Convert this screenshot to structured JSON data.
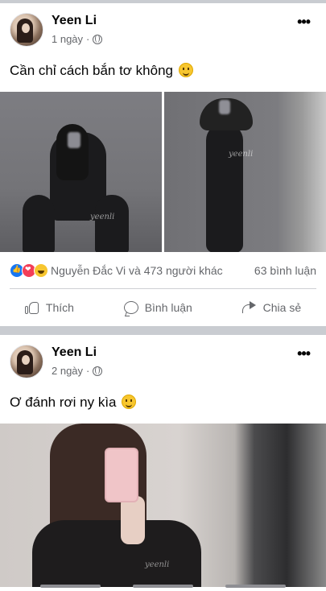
{
  "posts": [
    {
      "author": "Yeen Li",
      "time": "1 ngày",
      "caption": "Cần chỉ cách bắn tơ không",
      "reactions": {
        "icons": [
          "like-icon",
          "love-icon",
          "haha-icon"
        ],
        "text": "Nguyễn Đắc Vi và 473 người khác",
        "comments": "63 bình luận"
      },
      "actions": {
        "like": "Thích",
        "comment": "Bình luận",
        "share": "Chia sẻ"
      }
    },
    {
      "author": "Yeen Li",
      "time": "2 ngày",
      "caption": "Ơ đánh rơi ny kìa"
    }
  ],
  "colors": {
    "separator": "#c9ccd1",
    "secondary_text": "#65676b",
    "like_blue": "#1877f2",
    "love_red": "#f33e58",
    "haha_yellow": "#f7c62f"
  }
}
